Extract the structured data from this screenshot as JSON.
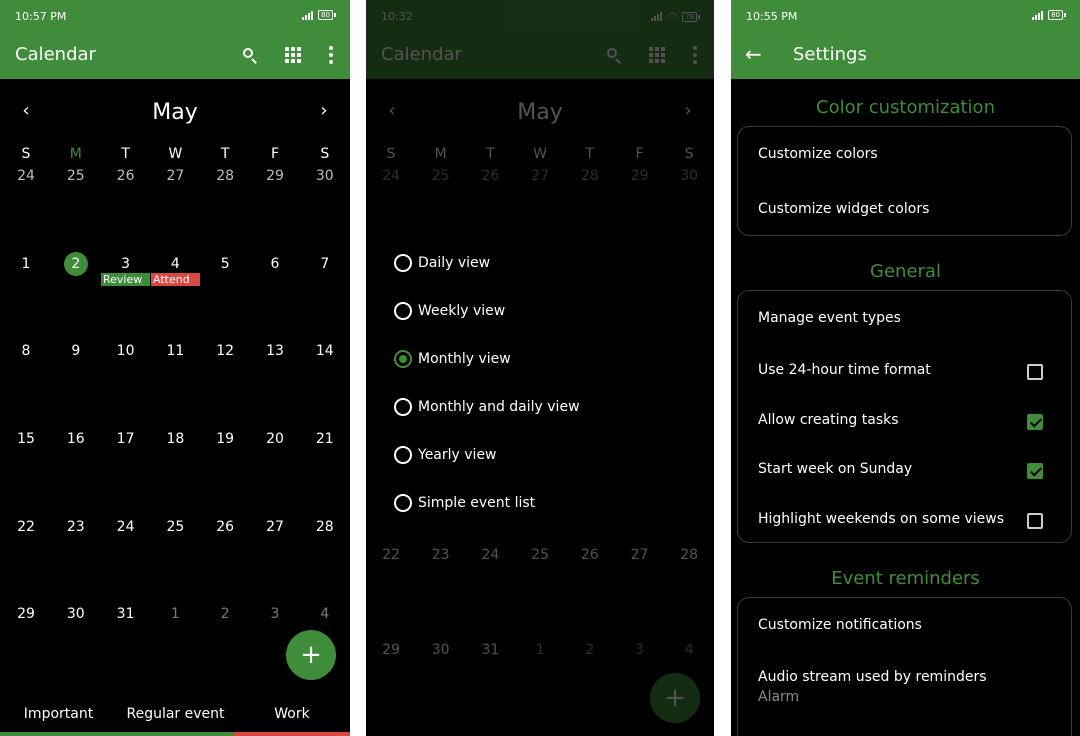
{
  "colors": {
    "accent": "#3f8d3a",
    "event_red": "#d94841",
    "background": "#000000"
  },
  "screen1": {
    "status_time": "10:57 PM",
    "battery": "80",
    "app_title": "Calendar",
    "month": "May",
    "weekdays": [
      "S",
      "M",
      "T",
      "W",
      "T",
      "F",
      "S"
    ],
    "weeks": [
      [
        "24",
        "25",
        "26",
        "27",
        "28",
        "29",
        "30"
      ],
      [
        "1",
        "2",
        "3",
        "4",
        "5",
        "6",
        "7"
      ],
      [
        "8",
        "9",
        "10",
        "11",
        "12",
        "13",
        "14"
      ],
      [
        "15",
        "16",
        "17",
        "18",
        "19",
        "20",
        "21"
      ],
      [
        "22",
        "23",
        "24",
        "25",
        "26",
        "27",
        "28"
      ],
      [
        "29",
        "30",
        "31",
        "1",
        "2",
        "3",
        "4"
      ]
    ],
    "today": "2",
    "events": [
      {
        "label": "Review",
        "color": "#3f8d3a"
      },
      {
        "label": "Attend",
        "color": "#d94841"
      }
    ],
    "fab_symbol": "+",
    "legend": [
      {
        "label": "Important",
        "color": "#3f8d3a"
      },
      {
        "label": "Regular event",
        "color": "#3f8d3a"
      },
      {
        "label": "Work",
        "color": "#d94841"
      }
    ]
  },
  "screen2": {
    "status_time": "10:32",
    "battery": "78",
    "app_title": "Calendar",
    "month": "May",
    "weekdays": [
      "S",
      "M",
      "T",
      "W",
      "T",
      "F",
      "S"
    ],
    "week1": [
      "24",
      "25",
      "26",
      "27",
      "28",
      "29",
      "30"
    ],
    "week5": [
      "22",
      "23",
      "24",
      "25",
      "26",
      "27",
      "28"
    ],
    "week6": [
      "29",
      "30",
      "31",
      "1",
      "2",
      "3",
      "4"
    ],
    "view_options": [
      {
        "label": "Daily view",
        "checked": false
      },
      {
        "label": "Weekly view",
        "checked": false
      },
      {
        "label": "Monthly view",
        "checked": true
      },
      {
        "label": "Monthly and daily view",
        "checked": false
      },
      {
        "label": "Yearly view",
        "checked": false
      },
      {
        "label": "Simple event list",
        "checked": false
      }
    ],
    "fab_symbol": "+"
  },
  "screen3": {
    "status_time": "10:55 PM",
    "battery": "80",
    "title": "Settings",
    "sections": {
      "color": {
        "header": "Color customization",
        "items": [
          "Customize colors",
          "Customize widget colors"
        ]
      },
      "general": {
        "header": "General",
        "manage": "Manage event types",
        "toggles": [
          {
            "label": "Use 24-hour time format",
            "checked": false
          },
          {
            "label": "Allow creating tasks",
            "checked": true
          },
          {
            "label": "Start week on Sunday",
            "checked": true
          },
          {
            "label": "Highlight weekends on some views",
            "checked": false
          }
        ]
      },
      "reminders": {
        "header": "Event reminders",
        "notifications": "Customize notifications",
        "audio_label": "Audio stream used by reminders",
        "audio_value": "Alarm"
      }
    }
  }
}
